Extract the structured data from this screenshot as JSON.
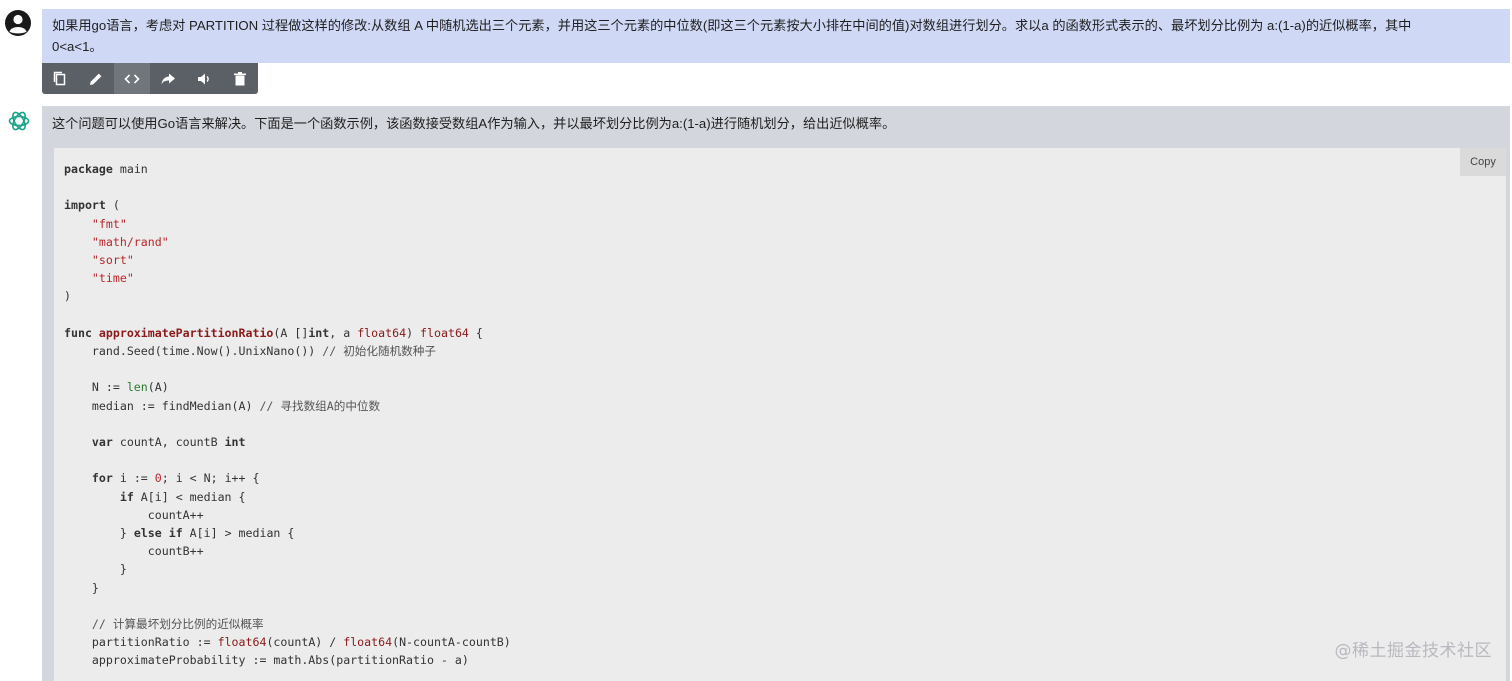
{
  "user": {
    "message_line1": "如果用go语言，考虑对 PARTITION 过程做这样的修改:从数组 A 中随机选出三个元素，并用这三个元素的中位数(即这三个元素按大小排在中间的值)对数组进行划分。求以a 的函数形式表示的、最坏划分比例为 a:(1-a)的近似概率，其中",
    "message_line2": "0<a<1。"
  },
  "toolbar": {
    "icons": [
      "copy-icon",
      "edit-icon",
      "code-icon",
      "share-icon",
      "speaker-icon",
      "trash-icon"
    ]
  },
  "assistant": {
    "intro": "这个问题可以使用Go语言来解决。下面是一个函数示例，该函数接受数组A作为输入，并以最坏划分比例为a:(1-a)进行随机划分，给出近似概率。",
    "copy_label": "Copy",
    "code_lines": [
      "package main",
      "",
      "import (",
      "    \"fmt\"",
      "    \"math/rand\"",
      "    \"sort\"",
      "    \"time\"",
      ")",
      "",
      "func approximatePartitionRatio(A []int, a float64) float64 {",
      "    rand.Seed(time.Now().UnixNano()) // 初始化随机数种子",
      "",
      "    N := len(A)",
      "    median := findMedian(A) // 寻找数组A的中位数",
      "",
      "    var countA, countB int",
      "",
      "    for i := 0; i < N; i++ {",
      "        if A[i] < median {",
      "            countA++",
      "        } else if A[i] > median {",
      "            countB++",
      "        }",
      "    }",
      "",
      "    // 计算最坏划分比例的近似概率",
      "    partitionRatio := float64(countA) / float64(N-countA-countB)",
      "    approximateProbability := math.Abs(partitionRatio - a)"
    ]
  },
  "watermark": "@稀土掘金技术社区"
}
